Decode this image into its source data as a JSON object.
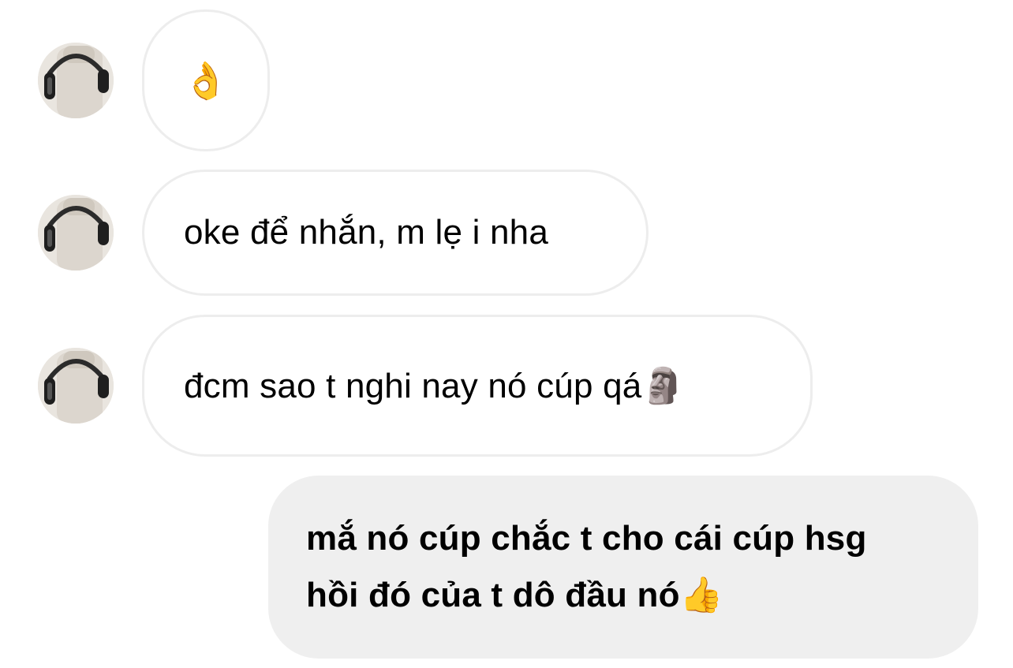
{
  "messages": [
    {
      "sender": "other",
      "text": "👌"
    },
    {
      "sender": "other",
      "text": "oke để nhắn, m lẹ i nha"
    },
    {
      "sender": "other",
      "text": "đcm sao t nghi nay nó cúp qá🗿"
    },
    {
      "sender": "self",
      "text": "mắ nó cúp chắc t cho cái cúp hsg hồi đó của t dô đầu nó👍"
    }
  ],
  "colors": {
    "incoming_bubble": "#ffffff",
    "incoming_border": "#ededed",
    "outgoing_bubble": "#efefef",
    "text": "#000000"
  },
  "icons": {
    "avatar": "profile-photo-headphones"
  }
}
